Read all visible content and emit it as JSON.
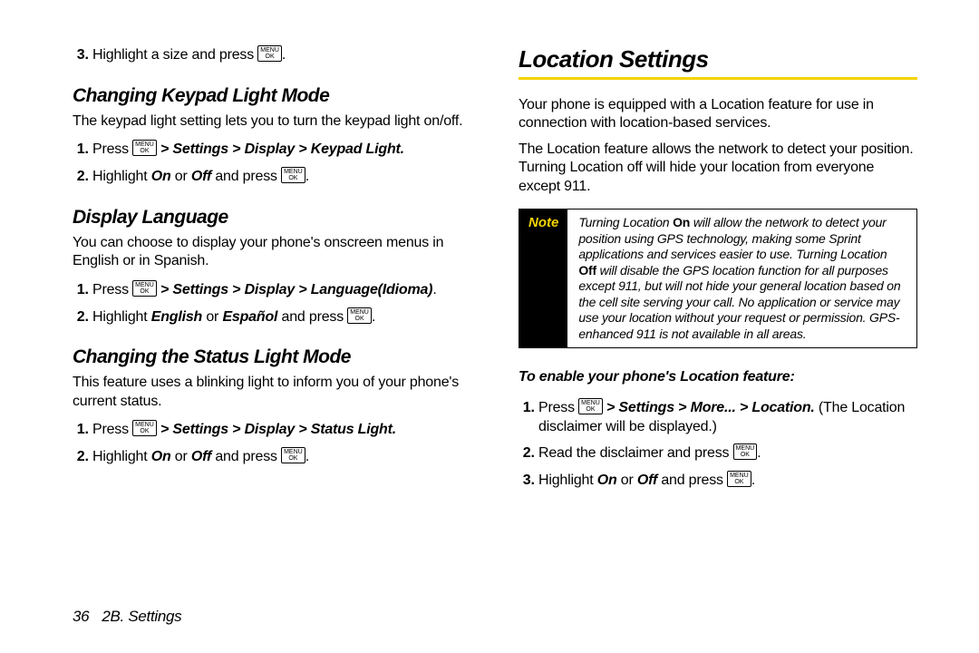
{
  "key": {
    "menu": "MENU",
    "ok": "OK"
  },
  "left": {
    "pre_item": {
      "n": "3.",
      "a": "Highlight a size and press ",
      "b": "."
    },
    "s1": {
      "heading": "Changing Keypad Light Mode",
      "intro": "The keypad light setting lets you to turn the keypad light on/off.",
      "steps": {
        "i1": {
          "a": "Press ",
          "path": " > Settings > Display > Keypad Light.",
          "end": ""
        },
        "i2": {
          "a": "Highlight ",
          "on": "On",
          "mid": " or ",
          "off": "Off",
          "b": " and press ",
          "end": "."
        }
      }
    },
    "s2": {
      "heading": "Display Language",
      "intro": "You can choose to display your phone's onscreen menus in English or in Spanish.",
      "steps": {
        "i1": {
          "a": "Press ",
          "path": " > Settings > Display > Language(Idioma)",
          "end": "."
        },
        "i2": {
          "a": "Highlight ",
          "en": "English",
          "mid": " or ",
          "es": "Español",
          "b": " and press ",
          "end": "."
        }
      }
    },
    "s3": {
      "heading": "Changing the Status Light Mode",
      "intro": "This feature uses a blinking light to inform you of your phone's current status.",
      "steps": {
        "i1": {
          "a": "Press ",
          "path": " > Settings > Display > Status Light.",
          "end": ""
        },
        "i2": {
          "a": "Highlight ",
          "on": "On",
          "mid": " or ",
          "off": "Off",
          "b": " and press ",
          "end": "."
        }
      }
    }
  },
  "right": {
    "heading": "Location Settings",
    "p1": "Your phone is equipped with a Location feature for use in connection with location-based services.",
    "p2": "The Location feature allows the network to detect your position. Turning Location off will hide your location from everyone except 911.",
    "note": {
      "label": "Note",
      "t1": "Turning Location ",
      "on": "On",
      "t2": " will allow the network to detect your position using GPS technology, making some Sprint applications and services easier to use. Turning Location ",
      "off": "Off",
      "t3": " will disable the GPS location function for all purposes except 911, but will not hide your general location based on the cell site serving your call. No application or service may use your location without your request or permission. GPS-enhanced 911 is not available in all areas."
    },
    "task": "To enable your phone's Location feature:",
    "steps": {
      "i1": {
        "a": "Press ",
        "path": " > Settings > More... > Location.",
        "b": " (The Location disclaimer will be displayed.)"
      },
      "i2": {
        "a": "Read the disclaimer and press ",
        "end": "."
      },
      "i3": {
        "a": "Highlight ",
        "on": "On",
        "mid": " or ",
        "off": "Off",
        "b": " and press ",
        "end": "."
      }
    }
  },
  "footer": {
    "page": "36",
    "section": "2B. Settings"
  }
}
